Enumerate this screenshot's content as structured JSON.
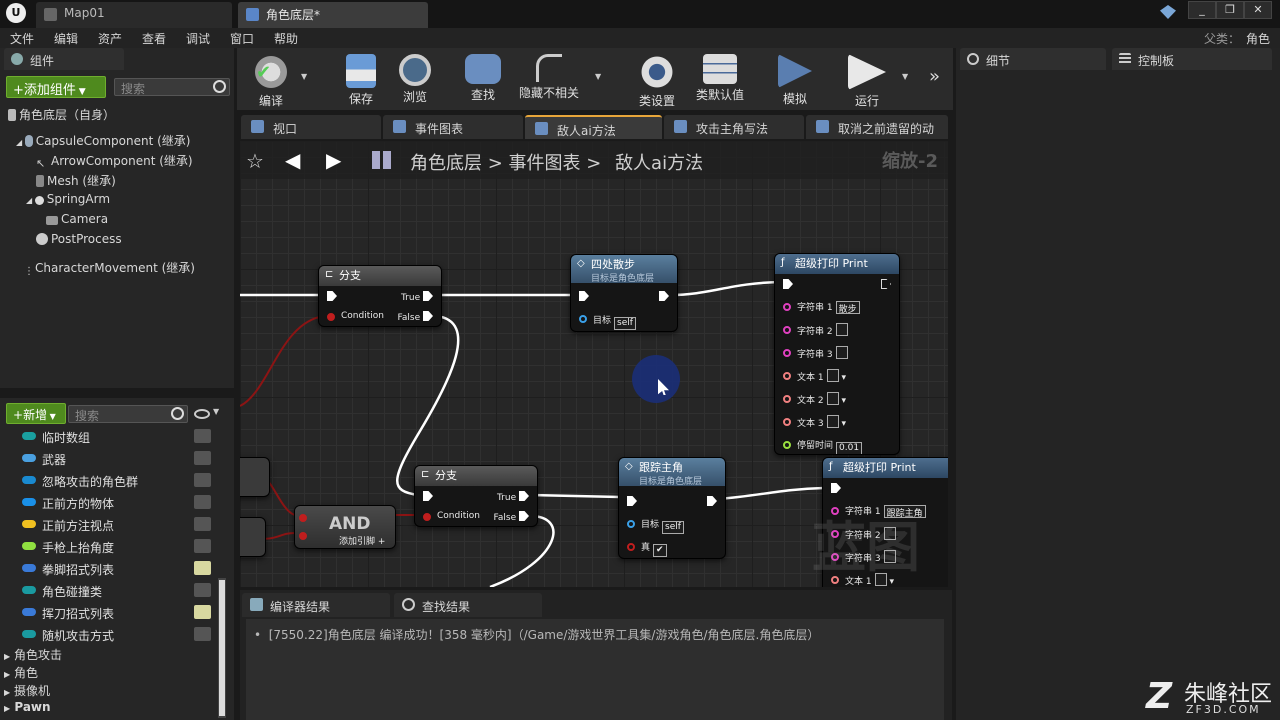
{
  "titlebar": {
    "tabs": [
      "Map01",
      "角色底层*"
    ],
    "parent_label": "父类：",
    "parent_value": "角色"
  },
  "menu": [
    "文件",
    "编辑",
    "资产",
    "查看",
    "调试",
    "窗口",
    "帮助"
  ],
  "components_panel": {
    "title": "组件",
    "add_button": "添加组件",
    "search_placeholder": "搜索",
    "root": "角色底层（自身）",
    "tree": [
      "CapsuleComponent (继承)",
      "ArrowComponent (继承)",
      "Mesh (继承)",
      "SpringArm",
      "Camera",
      "PostProcess",
      "CharacterMovement (继承)"
    ]
  },
  "variables_panel": {
    "new_button": "新增",
    "search_placeholder": "搜索",
    "items": [
      {
        "label": "临时数组",
        "color": "#1aa0a0",
        "eye": false
      },
      {
        "label": "武器",
        "color": "#4aa0e0",
        "eye": false
      },
      {
        "label": "忽略攻击的角色群",
        "color": "#1a8ad0",
        "eye": false
      },
      {
        "label": "正前方的物体",
        "color": "#1a90e8",
        "eye": false
      },
      {
        "label": "正前方注视点",
        "color": "#f0c020",
        "eye": false
      },
      {
        "label": "手枪上抬角度",
        "color": "#90e040",
        "eye": false
      },
      {
        "label": "拳脚招式列表",
        "color": "#3a7ad8",
        "eye": true
      },
      {
        "label": "角色碰撞类",
        "color": "#1a9aa0",
        "eye": false
      },
      {
        "label": "挥刀招式列表",
        "color": "#3a7ad8",
        "eye": true
      },
      {
        "label": "随机攻击方式",
        "color": "#1a9aa0",
        "eye": false
      }
    ],
    "categories": [
      "角色攻击",
      "角色",
      "摄像机",
      "Pawn"
    ]
  },
  "toolbar": {
    "buttons": [
      "编译",
      "保存",
      "浏览",
      "查找",
      "隐藏不相关",
      "类设置",
      "类默认值",
      "模拟",
      "运行"
    ]
  },
  "graph_tabs": [
    "视口",
    "事件图表",
    "敌人ai方法",
    "攻击主角写法",
    "取消之前遗留的动"
  ],
  "breadcrumb": {
    "parts": [
      "角色底层",
      "事件图表",
      "敌人ai方法"
    ],
    "zoom": "缩放-2"
  },
  "nodes": {
    "branch1": {
      "title": "分支",
      "true": "True",
      "false": "False",
      "cond": "Condition"
    },
    "wander": {
      "title": "四处散步",
      "sub": "目标是角色底层",
      "target": "目标",
      "self": "self"
    },
    "print1": {
      "title": "超级打印 Print",
      "s1": "字符串 1",
      "s1v": "散步",
      "s2": "字符串 2",
      "s3": "字符串 3",
      "t1": "文本 1",
      "t2": "文本 2",
      "t3": "文本 3",
      "dur": "停留时间",
      "durv": "0.01"
    },
    "branch2": {
      "title": "分支",
      "true": "True",
      "false": "False",
      "cond": "Condition"
    },
    "and": {
      "title": "AND",
      "add": "添加引脚"
    },
    "follow": {
      "title": "跟踪主角",
      "sub": "目标是角色底层",
      "target": "目标",
      "self": "self",
      "real": "真"
    },
    "print2": {
      "title": "超级打印 Print",
      "s1": "字符串 1",
      "s1v": "跟踪主角",
      "s2": "字符串 2",
      "s3": "字符串 3",
      "t1": "文本 1"
    }
  },
  "watermark_graph": "蓝图",
  "right_panel": {
    "details": "细节",
    "palette": "控制板"
  },
  "bottom": {
    "tabs": [
      "编译器结果",
      "查找结果"
    ],
    "log": "[7550.22]角色底层 编译成功！[358 毫秒内]（/Game/游戏世界工具集/游戏角色/角色底层.角色底层）"
  },
  "watermark": {
    "name": "朱峰社区",
    "url": "ZF3D.COM"
  },
  "colors": {
    "accent": "#e8a63a",
    "green": "#4f8a1e",
    "exec_wire": "#ffffff",
    "bool_wire": "#8c1414"
  }
}
